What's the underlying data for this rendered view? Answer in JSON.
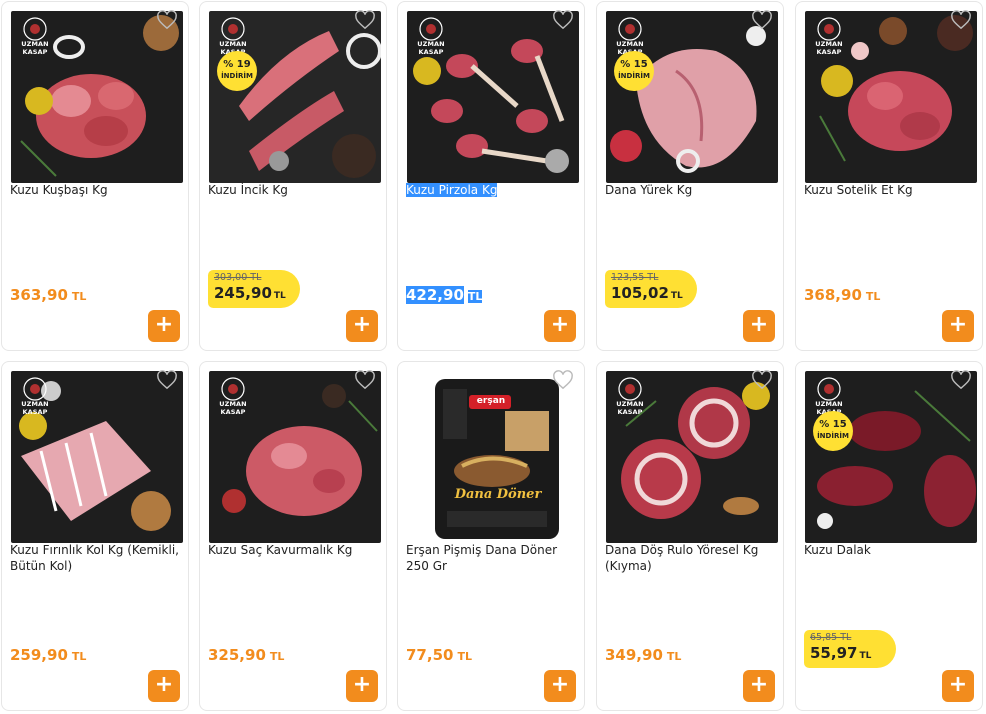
{
  "brand": "UZMAN KASAP",
  "add_label": "+",
  "currency": "TL",
  "products": [
    {
      "name": "Kuzu Kuşbaşı Kg",
      "price": "363,90"
    },
    {
      "name": "Kuzu İncik Kg",
      "old_price": "303,00 TL",
      "price": "245,90",
      "badge_pct": "% 19",
      "badge_label": "İNDİRİM"
    },
    {
      "name": "Kuzu Pirzola Kg",
      "price": "422,90"
    },
    {
      "name": "Dana Yürek Kg",
      "old_price": "123,55 TL",
      "price": "105,02",
      "badge_pct": "% 15",
      "badge_label": "İNDİRİM"
    },
    {
      "name": "Kuzu Sotelik Et Kg",
      "price": "368,90"
    },
    {
      "name": "Kuzu Fırınlık Kol Kg (Kemikli, Bütün Kol)",
      "price": "259,90"
    },
    {
      "name": "Kuzu Saç Kavurmalık Kg",
      "price": "325,90"
    },
    {
      "name": "Erşan Pişmiş Dana Döner 250 Gr",
      "price": "77,50",
      "pack_brand": "erşan",
      "pack_title": "Dana Döner"
    },
    {
      "name": "Dana Döş Rulo Yöresel Kg (Kıyma)",
      "price": "349,90"
    },
    {
      "name": "Kuzu Dalak",
      "old_price": "65,85 TL",
      "price": "55,97",
      "badge_pct": "% 15",
      "badge_label": "İNDİRİM"
    }
  ],
  "colors": {
    "accent": "#f28c1d",
    "discount": "#ffe033",
    "selection": "#3390ff"
  }
}
